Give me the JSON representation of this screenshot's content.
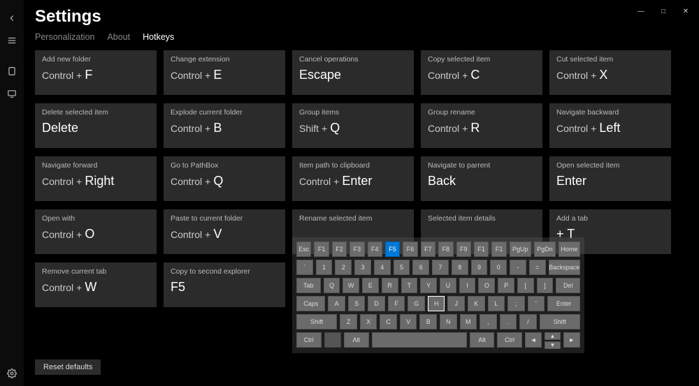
{
  "window": {
    "minimize": "—",
    "maximize": "□",
    "close": "✕"
  },
  "sidebar": {
    "back_tip": "Back",
    "menu_tip": "Menu",
    "tablet_tip": "Tablet",
    "monitor_tip": "Display",
    "settings_tip": "Settings"
  },
  "page_title": "Settings",
  "tabs": {
    "personalization": "Personalization",
    "about": "About",
    "hotkeys": "Hotkeys"
  },
  "active_tab": "hotkeys",
  "hotkeys": [
    {
      "label": "Add new folder",
      "mods": [
        "Control"
      ],
      "key": "F"
    },
    {
      "label": "Change extension",
      "mods": [
        "Control"
      ],
      "key": "E"
    },
    {
      "label": "Cancel operations",
      "mods": [],
      "key": "Escape"
    },
    {
      "label": "Copy selected item",
      "mods": [
        "Control"
      ],
      "key": "C"
    },
    {
      "label": "Cut selected item",
      "mods": [
        "Control"
      ],
      "key": "X"
    },
    {
      "label": "Delete selected item",
      "mods": [],
      "key": "Delete"
    },
    {
      "label": "Explode current folder",
      "mods": [
        "Control"
      ],
      "key": "B"
    },
    {
      "label": "Group items",
      "mods": [
        "Shift"
      ],
      "key": "Q"
    },
    {
      "label": "Group rename",
      "mods": [
        "Control"
      ],
      "key": "R"
    },
    {
      "label": "Navigate backward",
      "mods": [
        "Control"
      ],
      "key": "Left"
    },
    {
      "label": "Navigate forward",
      "mods": [
        "Control"
      ],
      "key": "Right"
    },
    {
      "label": "Go to PathBox",
      "mods": [
        "Control"
      ],
      "key": "Q"
    },
    {
      "label": "Item path to clipboard",
      "mods": [
        "Control"
      ],
      "key": "Enter"
    },
    {
      "label": "Navigate to parrent",
      "mods": [],
      "key": "Back"
    },
    {
      "label": "Open selected item",
      "mods": [],
      "key": "Enter"
    },
    {
      "label": "Open with",
      "mods": [
        "Control"
      ],
      "key": "O"
    },
    {
      "label": "Paste to current folder",
      "mods": [
        "Control"
      ],
      "key": "V"
    },
    {
      "label": "Rename selected item",
      "mods": [],
      "key": ""
    },
    {
      "label": "Selected item details",
      "mods": [],
      "key": ""
    },
    {
      "label": "Add a tab",
      "mods": [],
      "key": "+ T"
    },
    {
      "label": "Remove current tab",
      "mods": [
        "Control"
      ],
      "key": "W"
    },
    {
      "label": "Copy to second explorer",
      "mods": [],
      "key": "F5"
    }
  ],
  "reset_label": "Reset defaults",
  "keyboard": {
    "active_key": "F5",
    "outlined_key": "H",
    "rows": [
      [
        "Esc",
        "F1",
        "F2",
        "F3",
        "F4",
        "F5",
        "F6",
        "F7",
        "F8",
        "F9",
        "F1",
        "F1",
        "PgUp",
        "PgDn",
        "Home"
      ],
      [
        "`",
        "1",
        "2",
        "3",
        "4",
        "5",
        "6",
        "7",
        "8",
        "9",
        "0",
        "-",
        "=",
        "Backspace"
      ],
      [
        "Tab",
        "Q",
        "W",
        "E",
        "R",
        "T",
        "Y",
        "U",
        "I",
        "O",
        "P",
        "[",
        "]",
        "Del"
      ],
      [
        "Caps",
        "A",
        "S",
        "D",
        "F",
        "G",
        "H",
        "J",
        "K",
        "L",
        ";",
        "'",
        "Enter"
      ],
      [
        "Shift",
        "Z",
        "X",
        "C",
        "V",
        "B",
        "N",
        "M",
        ",",
        ".",
        "/",
        "Shift"
      ],
      [
        "Ctrl",
        "",
        "Alt",
        "Space",
        "Alt",
        "Ctrl",
        "◄",
        "▲▼",
        "►"
      ]
    ]
  }
}
